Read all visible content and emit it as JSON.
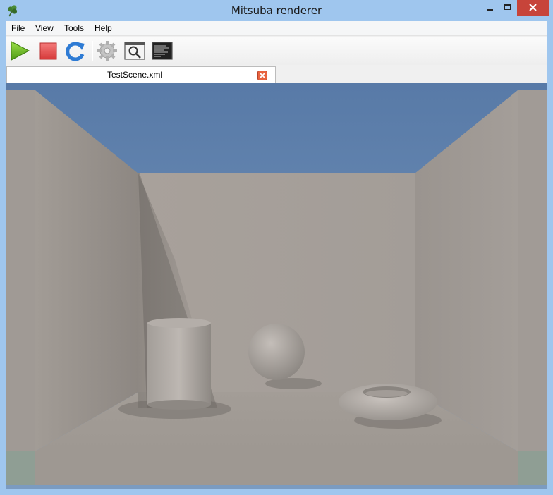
{
  "window": {
    "title": "Mitsuba renderer",
    "app_icon": "clover-icon"
  },
  "menu": {
    "items": [
      {
        "label": "File"
      },
      {
        "label": "View"
      },
      {
        "label": "Tools"
      },
      {
        "label": "Help"
      }
    ]
  },
  "toolbar": {
    "buttons": [
      {
        "icon": "play-icon",
        "color": "#6bbf1f"
      },
      {
        "icon": "stop-icon",
        "color": "#e24a4a"
      },
      {
        "icon": "refresh-icon",
        "color": "#2e7bd4"
      },
      {
        "icon": "settings-gear-icon",
        "color": "#b5b5b5"
      },
      {
        "icon": "magnifier-preview-icon",
        "color": "#444444"
      },
      {
        "icon": "console-log-icon",
        "color": "#222222"
      }
    ]
  },
  "tabs": [
    {
      "label": "TestScene.xml",
      "close_icon": "close-tab-icon"
    }
  ],
  "render": {
    "scene": "Cornell-style room with cylinder, sphere and torus",
    "sky_color": "#5b7fb0",
    "wall_color": "#a8a19b"
  }
}
